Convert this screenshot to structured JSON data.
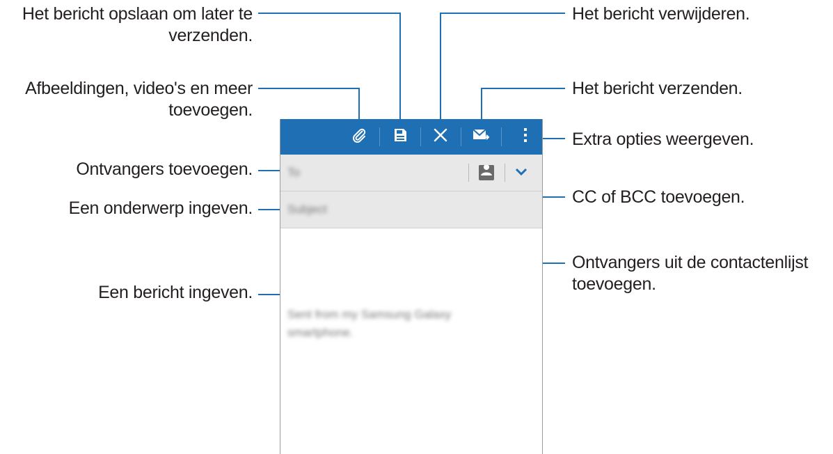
{
  "callouts": {
    "save_line1": "Het bericht opslaan om later te",
    "save_line2": "verzenden.",
    "attach_line1": "Afbeeldingen, video's en meer",
    "attach_line2": "toevoegen.",
    "recipients": "Ontvangers toevoegen.",
    "subject": "Een onderwerp ingeven.",
    "message": "Een bericht ingeven.",
    "delete": "Het bericht verwijderen.",
    "send": "Het bericht verzenden.",
    "more": "Extra opties weergeven.",
    "ccbcc": "CC of BCC toevoegen.",
    "contacts_line1": "Ontvangers uit de contactenlijst",
    "contacts_line2": "toevoegen."
  },
  "screen": {
    "to_placeholder": "To",
    "subject_placeholder": "Subject",
    "body_line1": "Sent from my Samsung Galaxy",
    "body_line2": "smartphone."
  },
  "icons": {
    "attach": "paperclip-icon",
    "save": "save-icon",
    "delete": "close-icon",
    "send": "send-mail-icon",
    "more": "more-vert-icon",
    "contacts": "contact-icon",
    "expand": "chevron-down-icon"
  },
  "colors": {
    "accent": "#1f6fb4",
    "field_bg": "#e8e8e8"
  }
}
